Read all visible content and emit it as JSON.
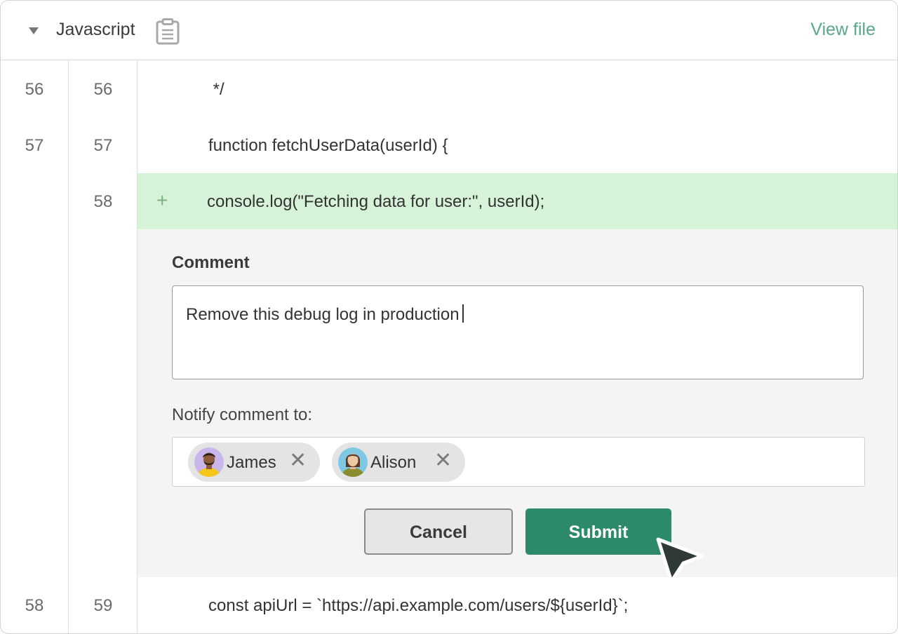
{
  "header": {
    "language": "Javascript",
    "view_file_label": "View file"
  },
  "diff_lines": [
    {
      "old": "56",
      "new": "56",
      "code": " */"
    },
    {
      "old": "57",
      "new": "57",
      "code": "function fetchUserData(userId) {"
    },
    {
      "old": "",
      "new": "58",
      "code": "console.log(\"Fetching data for user:\", userId);",
      "marker": "+"
    },
    {
      "old": "58",
      "new": "59",
      "code": "const apiUrl = `https://api.example.com/users/${userId}`;"
    }
  ],
  "comment": {
    "label": "Comment",
    "value": "Remove this debug log in production",
    "notify_label": "Notify comment to:",
    "recipients": [
      {
        "name": "James",
        "remove_icon": "close-icon"
      },
      {
        "name": "Alison",
        "remove_icon": "close-icon"
      }
    ],
    "cancel_label": "Cancel",
    "submit_label": "Submit"
  },
  "colors": {
    "accent": "#2c8a6a",
    "link": "#5aa889",
    "added_line_bg": "#d6f2d7",
    "panel_bg": "#f4f4f4"
  }
}
